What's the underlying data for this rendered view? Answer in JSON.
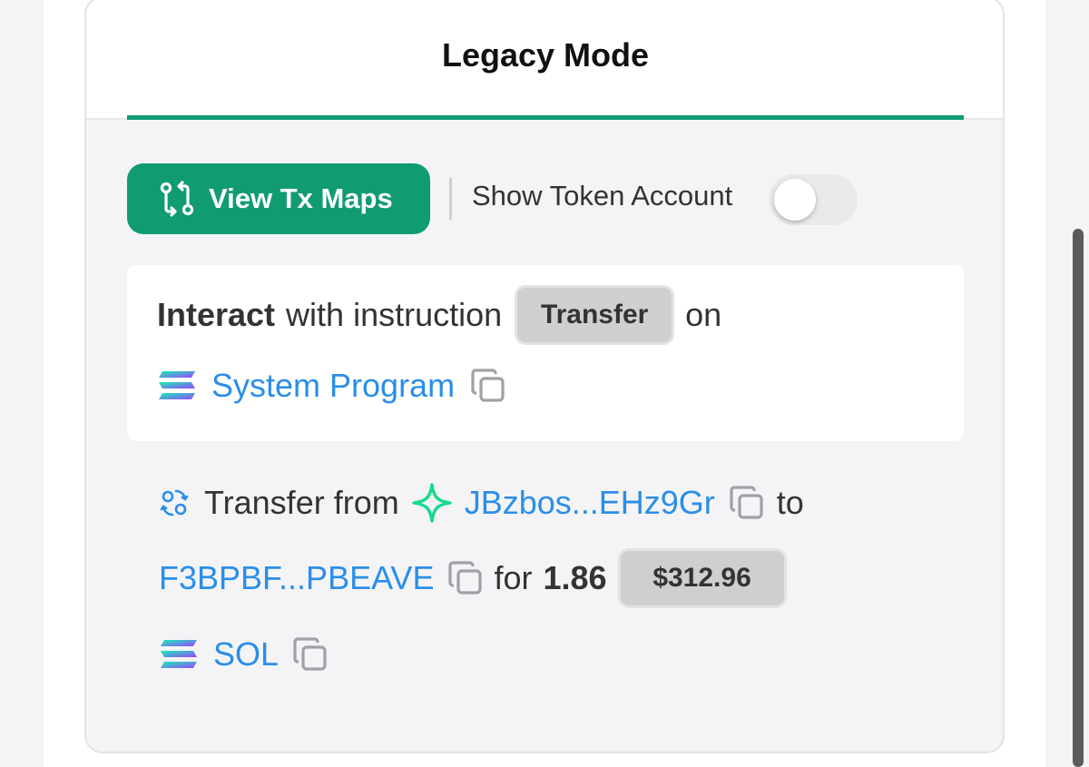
{
  "tab": {
    "label": "Legacy Mode"
  },
  "toolbar": {
    "view_tx_maps_label": "View Tx Maps",
    "show_token_account_label": "Show Token Account",
    "show_token_account_on": false
  },
  "instruction": {
    "prefix_bold": "Interact",
    "middle_text": "with instruction",
    "instruction_badge": "Transfer",
    "suffix_text": "on",
    "program_name": "System Program"
  },
  "transfer": {
    "prefix": "Transfer from",
    "from_address": "JBzbos...EHz9Gr",
    "to_word": "to",
    "to_address": "F3BPBF...PBEAVE",
    "for_word": "for",
    "amount": "1.86",
    "usd_value": "$312.96",
    "token": "SOL"
  },
  "colors": {
    "accent_green": "#119b73",
    "link_blue": "#2a8ee8"
  },
  "icons": {
    "tx_maps": "route-icon",
    "program": "solana-logo-icon",
    "transfer": "transfer-icon",
    "from_wallet": "sparkle-icon",
    "copy": "copy-icon"
  }
}
